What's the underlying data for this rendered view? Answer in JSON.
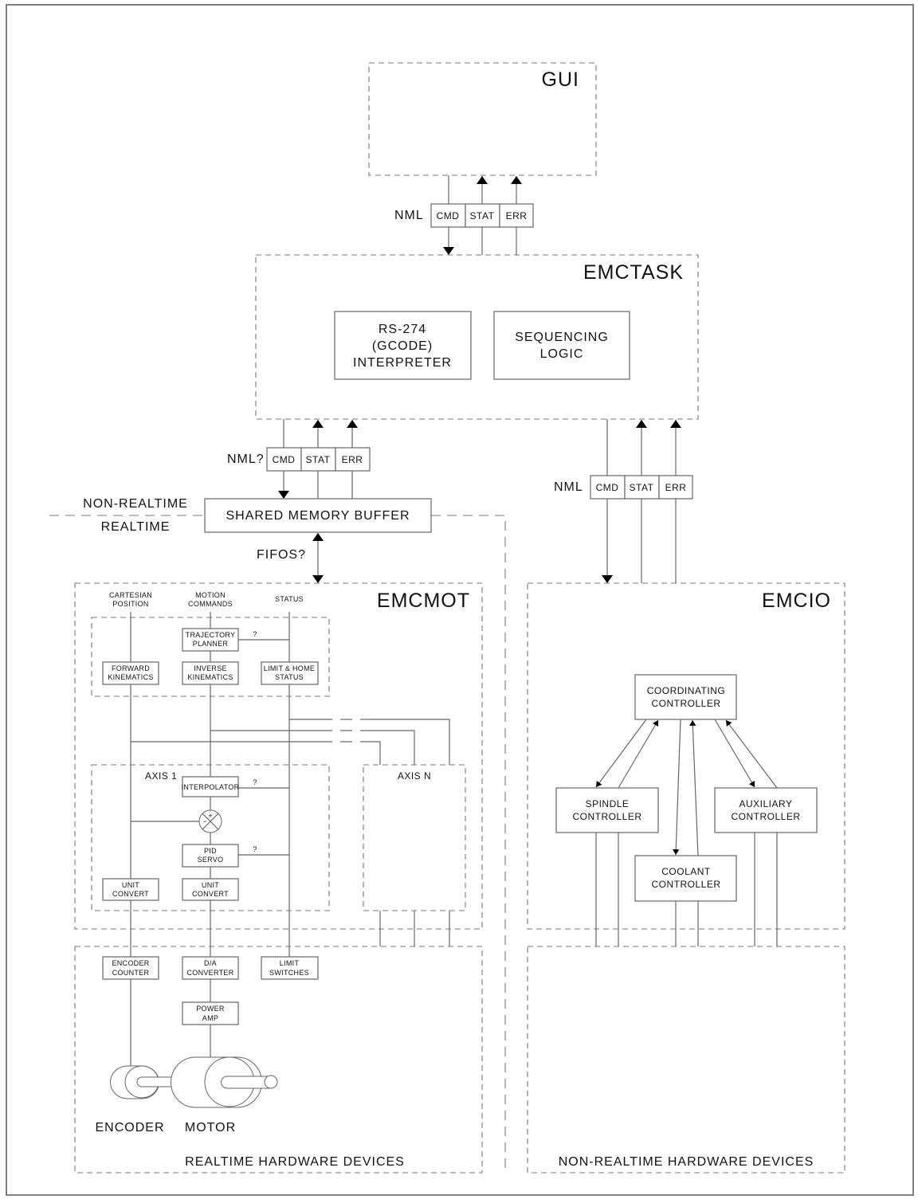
{
  "gui": {
    "title": "GUI"
  },
  "nml_top": {
    "label": "NML",
    "channels": [
      "CMD",
      "STAT",
      "ERR"
    ]
  },
  "emctask": {
    "title": "EMCTASK",
    "interpreter": [
      "RS-274",
      "(GCODE)",
      "INTERPRETER"
    ],
    "sequencing": [
      "SEQUENCING",
      "LOGIC"
    ]
  },
  "nml_mot": {
    "label": "NML?",
    "channels": [
      "CMD",
      "STAT",
      "ERR"
    ]
  },
  "nml_io": {
    "label": "NML",
    "channels": [
      "CMD",
      "STAT",
      "ERR"
    ]
  },
  "boundary": {
    "upper": "NON-REALTIME",
    "lower": "REALTIME"
  },
  "shm": {
    "label": "SHARED MEMORY BUFFER"
  },
  "fifos": {
    "label": "FIFOS?"
  },
  "emcmot": {
    "title": "EMCMOT",
    "columns": [
      [
        "CARTESIAN",
        "POSITION"
      ],
      [
        "MOTION",
        "COMMANDS"
      ],
      [
        "STATUS"
      ]
    ],
    "trajectory_planner": [
      "TRAJECTORY",
      "PLANNER"
    ],
    "forward_kinematics": [
      "FORWARD",
      "KINEMATICS"
    ],
    "inverse_kinematics": [
      "INVERSE",
      "KINEMATICS"
    ],
    "limit_home": [
      "LIMIT & HOME",
      "STATUS"
    ],
    "question": "?",
    "axis1": {
      "title": "AXIS 1",
      "interpolator": "INTERPOLATOR",
      "pid": [
        "PID",
        "SERVO"
      ],
      "unit_convert_left": [
        "UNIT",
        "CONVERT"
      ],
      "unit_convert_mid": [
        "UNIT",
        "CONVERT"
      ],
      "summing_signs": [
        "+",
        "−"
      ]
    },
    "axisn": {
      "title": "AXIS N"
    }
  },
  "rt_hw": {
    "title": "REALTIME HARDWARE DEVICES",
    "encoder_counter": [
      "ENCODER",
      "COUNTER"
    ],
    "da_converter": [
      "D/A",
      "CONVERTER"
    ],
    "limit_switches": [
      "LIMIT",
      "SWITCHES"
    ],
    "power_amp": [
      "POWER",
      "AMP"
    ],
    "encoder": "ENCODER",
    "motor": "MOTOR"
  },
  "emcio": {
    "title": "EMCIO",
    "coordinating": [
      "COORDINATING",
      "CONTROLLER"
    ],
    "spindle": [
      "SPINDLE",
      "CONTROLLER"
    ],
    "auxiliary": [
      "AUXILIARY",
      "CONTROLLER"
    ],
    "coolant": [
      "COOLANT",
      "CONTROLLER"
    ]
  },
  "nrt_hw": {
    "title": "NON-REALTIME HARDWARE DEVICES"
  }
}
